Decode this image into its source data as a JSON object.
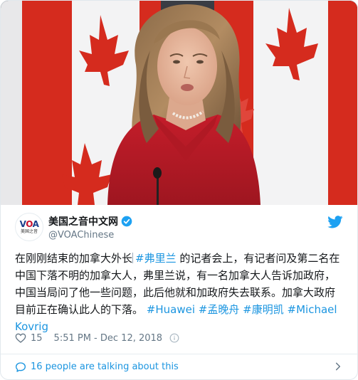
{
  "account": {
    "display_name": "美国之音中文网",
    "handle": "@VOAChinese",
    "logo_text": "VOA",
    "logo_subtext": "美国之音",
    "verified": true
  },
  "tweet": {
    "text_before": "在刚刚结束的加拿大外长",
    "hashtag_1": "#弗里兰",
    "text_middle": " 的记者会上，有记者问及第二名在中国下落不明的加拿大人，弗里兰说，有一名加拿大人告诉加政府，中国当局问了他一些问题，此后他就和加政府失去联系。加拿大政府目前正在确认此人的下落。",
    "hashtag_2": "#Huawei",
    "hashtag_3": "#孟晚舟",
    "hashtag_4": "#康明凯",
    "hashtag_5": "#MichaelKovrig"
  },
  "meta": {
    "like_count": "15",
    "timestamp": "5:51 PM - Dec 12, 2018"
  },
  "footer": {
    "talking_label": "16 people are talking about this"
  },
  "colors": {
    "link": "#1b95e0",
    "text": "#14171a",
    "secondary": "#657786",
    "twitter_blue": "#1da1f2",
    "flag_red": "#d52b1e"
  },
  "icons": {
    "verified": "verified-badge-icon",
    "bird": "twitter-bird-icon",
    "like": "heart-icon",
    "info": "info-icon",
    "comments": "speech-bubble-icon",
    "expand": "chevron-right-icon"
  }
}
